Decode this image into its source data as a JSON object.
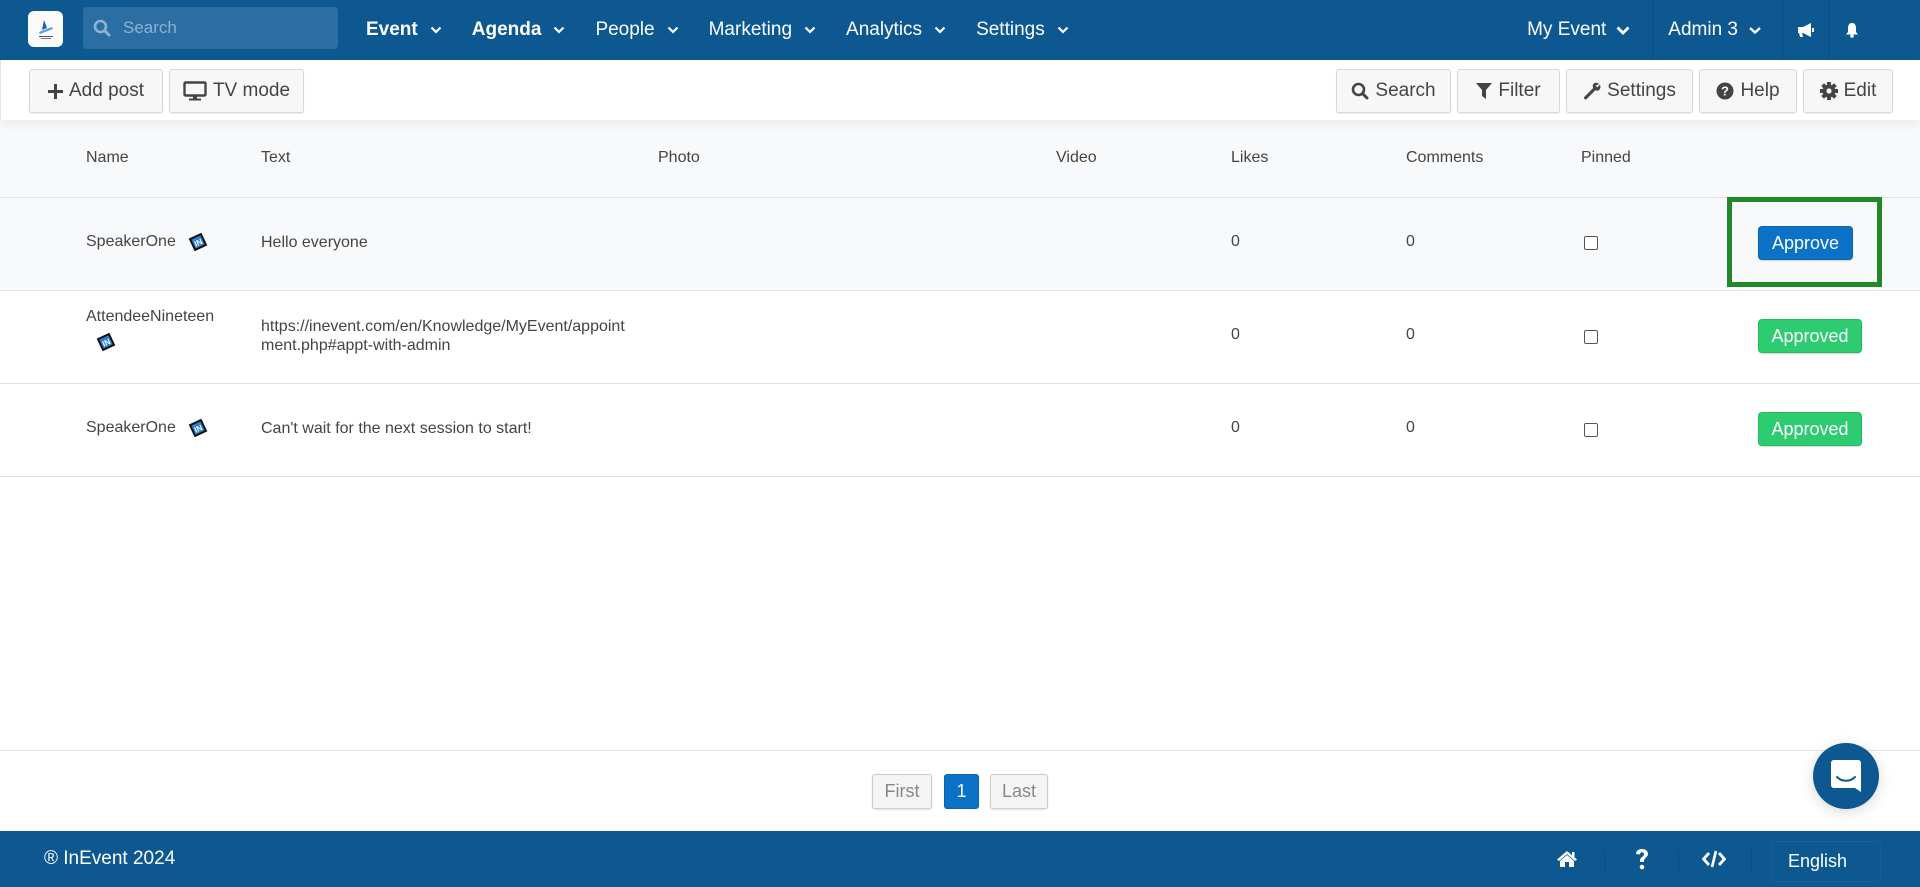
{
  "topnav": {
    "logo_icon": "inevent-logo-icon",
    "search_placeholder": "Search",
    "menu": [
      {
        "label": "Event"
      },
      {
        "label": "Agenda"
      },
      {
        "label": "People"
      },
      {
        "label": "Marketing"
      },
      {
        "label": "Analytics"
      },
      {
        "label": "Settings"
      }
    ],
    "event_selector": "My Event",
    "user_menu": "Admin 3",
    "announcements_icon": "megaphone-icon",
    "notifications_icon": "bell-icon"
  },
  "toolbar": {
    "add_post": "Add post",
    "tv_mode": "TV mode",
    "search": "Search",
    "filter": "Filter",
    "settings": "Settings",
    "help": "Help",
    "edit": "Edit"
  },
  "table": {
    "columns": [
      "Name",
      "Text",
      "Photo",
      "Video",
      "Likes",
      "Comments",
      "Pinned"
    ],
    "rows": [
      {
        "name": "SpeakerOne",
        "text": "Hello everyone",
        "photo": "",
        "video": "",
        "likes": "0",
        "comments": "0",
        "pinned": false,
        "action": "Approve",
        "status": "pending"
      },
      {
        "name": "AttendeeNineteen",
        "text": "https://inevent.com/en/Knowledge/MyEvent/appointment.php#appt-with-admin",
        "photo": "",
        "video": "",
        "likes": "0",
        "comments": "0",
        "pinned": false,
        "action": "Approved",
        "status": "approved"
      },
      {
        "name": "SpeakerOne",
        "text": "Can't wait for the next session to start!",
        "photo": "",
        "video": "",
        "likes": "0",
        "comments": "0",
        "pinned": false,
        "action": "Approved",
        "status": "approved"
      }
    ]
  },
  "pagination": {
    "first": "First",
    "current": "1",
    "last": "Last"
  },
  "footer": {
    "copyright": "® InEvent 2024",
    "language": "English"
  },
  "colors": {
    "brand": "#0e5892",
    "primary_button": "#0b72c7",
    "approved": "#2ecc71",
    "highlight": "#22882a"
  }
}
